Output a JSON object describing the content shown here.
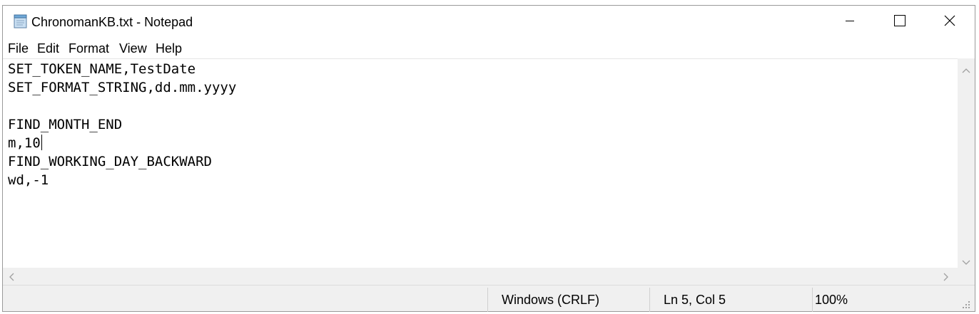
{
  "window": {
    "title": "ChronomanKB.txt - Notepad",
    "icons": {
      "app": "notepad-icon",
      "minimize": "minimize-icon",
      "maximize": "maximize-icon",
      "close": "close-icon"
    }
  },
  "menu": {
    "file": "File",
    "edit": "Edit",
    "format": "Format",
    "view": "View",
    "help": "Help"
  },
  "editor": {
    "lines": [
      "SET_TOKEN_NAME,TestDate",
      "SET_FORMAT_STRING,dd.mm.yyyy",
      "",
      "FIND_MONTH_END",
      "m,10",
      "FIND_WORKING_DAY_BACKWARD",
      "wd,-1"
    ]
  },
  "status": {
    "line_ending": "Windows (CRLF)",
    "position": "Ln 5, Col 5",
    "zoom": "100%"
  },
  "colors": {
    "chrome_bg": "#f0f0f0",
    "text": "#000000",
    "border": "#9a9a9a"
  }
}
